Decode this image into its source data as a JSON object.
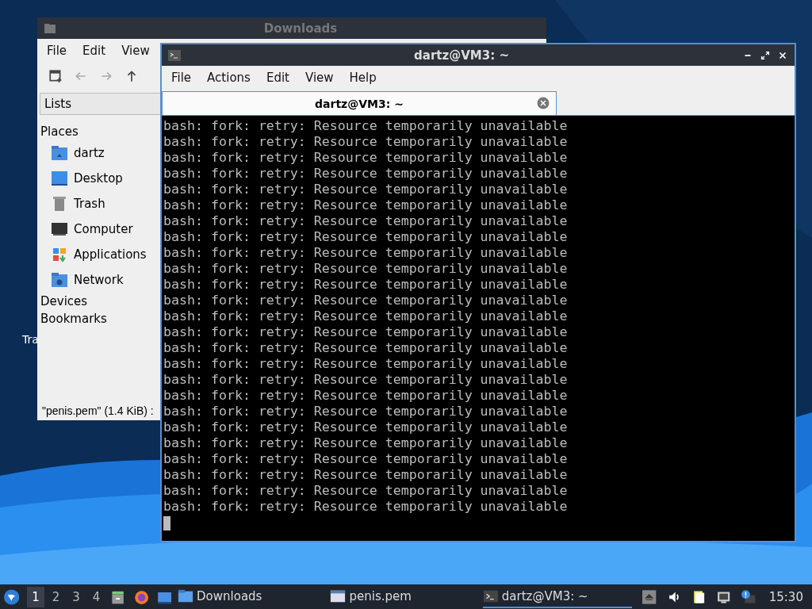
{
  "desktop_icons": [
    {
      "label": "Tra"
    }
  ],
  "file_manager": {
    "title": "Downloads",
    "menu": [
      "File",
      "Edit",
      "View"
    ],
    "location": "Lists",
    "sidebar": [
      {
        "kind": "header",
        "label": "Places"
      },
      {
        "kind": "home",
        "label": "dartz"
      },
      {
        "kind": "desktop",
        "label": "Desktop"
      },
      {
        "kind": "trash",
        "label": "Trash"
      },
      {
        "kind": "computer",
        "label": "Computer"
      },
      {
        "kind": "apps",
        "label": "Applications"
      },
      {
        "kind": "network",
        "label": "Network"
      },
      {
        "kind": "header",
        "label": "Devices"
      },
      {
        "kind": "header",
        "label": "Bookmarks"
      }
    ],
    "status": "\"penis.pem\" (1.4 KiB) :"
  },
  "terminal": {
    "title": "dartz@VM3: ~",
    "menu": [
      "File",
      "Actions",
      "Edit",
      "View",
      "Help"
    ],
    "tabs": [
      {
        "label": "dartz@VM3: ~",
        "selected": true
      }
    ],
    "lines": [
      "bash: fork: retry: Resource temporarily unavailable",
      "bash: fork: retry: Resource temporarily unavailable",
      "bash: fork: retry: Resource temporarily unavailable",
      "bash: fork: retry: Resource temporarily unavailable",
      "bash: fork: retry: Resource temporarily unavailable",
      "bash: fork: retry: Resource temporarily unavailable",
      "bash: fork: retry: Resource temporarily unavailable",
      "bash: fork: retry: Resource temporarily unavailable",
      "bash: fork: retry: Resource temporarily unavailable",
      "bash: fork: retry: Resource temporarily unavailable",
      "bash: fork: retry: Resource temporarily unavailable",
      "bash: fork: retry: Resource temporarily unavailable",
      "bash: fork: retry: Resource temporarily unavailable",
      "bash: fork: retry: Resource temporarily unavailable",
      "bash: fork: retry: Resource temporarily unavailable",
      "bash: fork: retry: Resource temporarily unavailable",
      "bash: fork: retry: Resource temporarily unavailable",
      "bash: fork: retry: Resource temporarily unavailable",
      "bash: fork: retry: Resource temporarily unavailable",
      "bash: fork: retry: Resource temporarily unavailable",
      "bash: fork: retry: Resource temporarily unavailable",
      "bash: fork: retry: Resource temporarily unavailable",
      "bash: fork: retry: Resource temporarily unavailable",
      "bash: fork: retry: Resource temporarily unavailable",
      "bash: fork: retry: Resource temporarily unavailable"
    ]
  },
  "taskbar": {
    "workspaces": [
      {
        "label": "1",
        "selected": true
      },
      {
        "label": "2",
        "selected": false
      },
      {
        "label": "3",
        "selected": false
      },
      {
        "label": "4",
        "selected": false
      }
    ],
    "tasks": [
      {
        "kind": "folder",
        "label": "Downloads",
        "selected": false
      },
      {
        "kind": "file",
        "label": "penis.pem",
        "selected": false
      },
      {
        "kind": "terminal",
        "label": "dartz@VM3: ~",
        "selected": true
      }
    ],
    "clock": "15:30"
  }
}
